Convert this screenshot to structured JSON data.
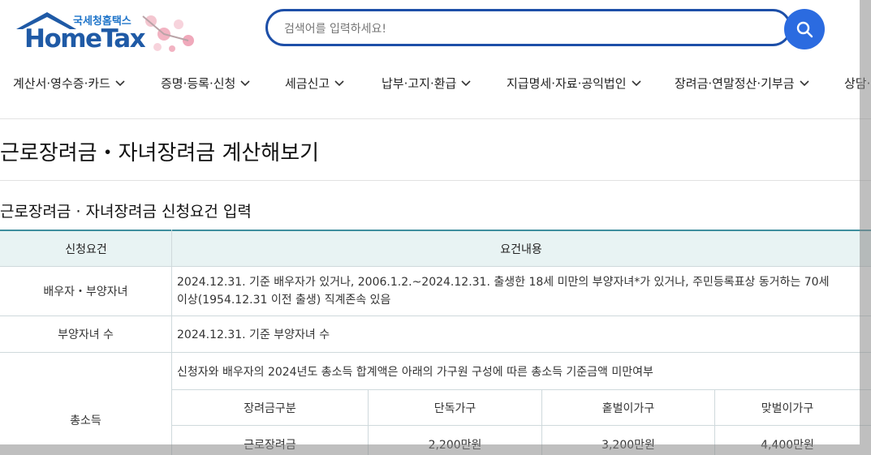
{
  "logo": {
    "sub": "국세청홈택스",
    "main": "HomeTax"
  },
  "search": {
    "placeholder": "검색어를 입력하세요!"
  },
  "nav": [
    "계산서·영수증·카드",
    "증명·등록·신청",
    "세금신고",
    "납부·고지·환급",
    "지급명세·자료·공익법인",
    "장려금·연말정산·기부금",
    "상담·"
  ],
  "page_title": "근로장려금・자녀장려금 계산해보기",
  "section_title": "근로장려금 · 자녀장려금 신청요건 입력",
  "table": {
    "headers": [
      "신청요건",
      "요건내용"
    ],
    "rows": [
      {
        "label": "배우자・부양자녀",
        "content_line1": "2024.12.31. 기준 배우자가 있거나, 2006.1.2.~2024.12.31. 출생한 18세 미만의 부양자녀*가 있거나, 주민등록표상 동거하는 70세",
        "content_line2": "이상(1954.12.31 이전 출생) 직계존속 있음"
      },
      {
        "label": "부양자녀 수",
        "content_line1": "2024.12.31. 기준 부양자녀 수"
      },
      {
        "label": "총소득",
        "content_line1": "신청자와 배우자의 2024년도 총소득 합계액은 아래의 가구원 구성에 따른 총소득 기준금액 미만여부",
        "sub_headers": [
          "장려금구분",
          "단독가구",
          "홑벌이가구",
          "맞벌이가구"
        ],
        "sub_row": [
          "근로장려금",
          "2,200만원",
          "3,200만원",
          "4,400만원"
        ]
      }
    ]
  },
  "colors": {
    "brand": "#1f5aa6",
    "search_button": "#2b6be0",
    "header_accent": "#3f8e9e",
    "header_bg": "#e8f3f3"
  }
}
